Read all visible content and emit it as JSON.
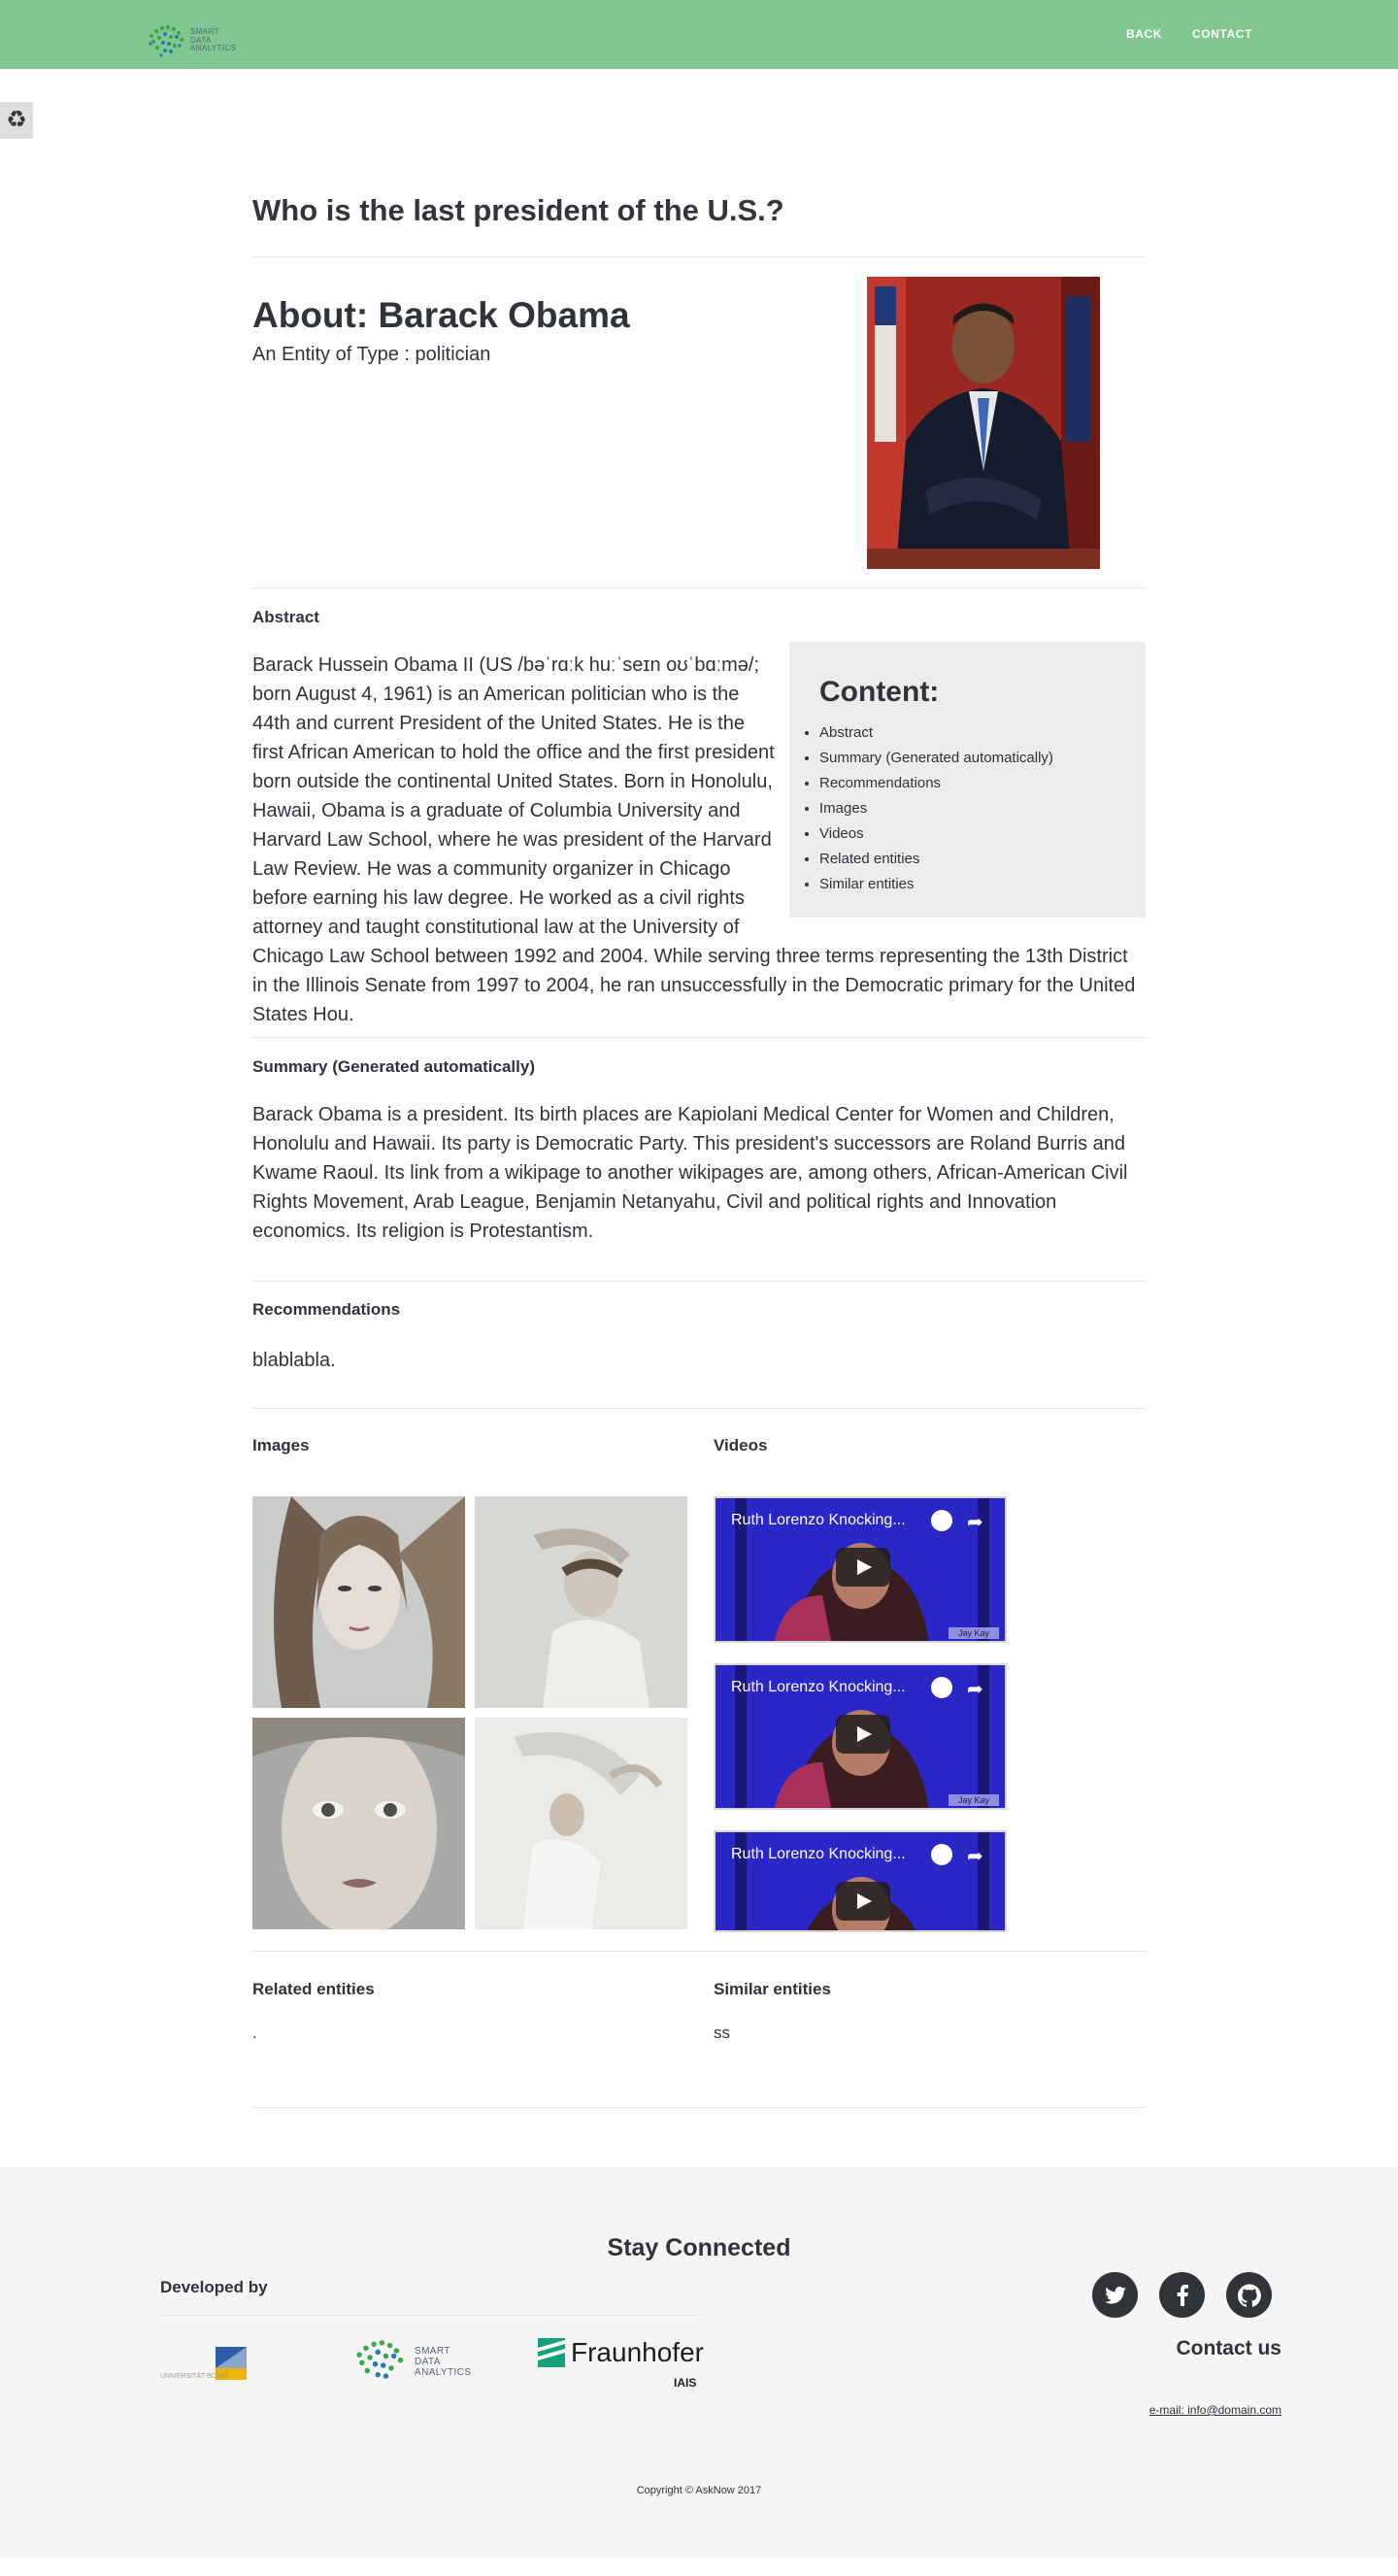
{
  "nav": {
    "brand": [
      "SMART",
      "DATA",
      "ANALYTICS"
    ],
    "links": [
      "BACK",
      "CONTACT"
    ]
  },
  "side_tab_icon": "recycle-icon",
  "question": "Who is the last president of the U.S.?",
  "about": {
    "title": "About: Barack Obama",
    "type_line": "An Entity of Type : politician"
  },
  "abstract": {
    "label": "Abstract",
    "text": "Barack Hussein Obama II (US /bəˈrɑːk huːˈseɪn oʊˈbɑːmə/; born August 4, 1961) is an American politician who is the 44th and current President of the United States. He is the first African American to hold the office and the first president born outside the continental United States. Born in Honolulu, Hawaii, Obama is a graduate of Columbia University and Harvard Law School, where he was president of the Harvard Law Review. He was a community organizer in Chicago before earning his law degree. He worked as a civil rights attorney and taught constitutional law at the University of Chicago Law School between 1992 and 2004. While serving three terms representing the 13th District in the Illinois Senate from 1997 to 2004, he ran unsuccessfully in the Democratic primary for the United States Hou."
  },
  "contents": {
    "title": "Content:",
    "items": [
      "Abstract",
      "Summary (Generated automatically)",
      "Recommendations",
      "Images",
      "Videos",
      "Related entities",
      "Similar entities"
    ]
  },
  "summary": {
    "label": "Summary (Generated automatically)",
    "text": "Barack Obama is a president. Its birth places are Kapiolani Medical Center for Women and Children, Honolulu and Hawaii. Its party is Democratic Party. This president's successors are Roland Burris and Kwame Raoul. Its link from a wikipage to another wikipages are, among others, African-American Civil Rights Movement, Arab League, Benjamin Netanyahu, Civil and political rights and Innovation economics. Its religion is Protestantism."
  },
  "recommendations": {
    "label": "Recommendations",
    "text": "blablabla."
  },
  "images": {
    "label": "Images"
  },
  "videos": {
    "label": "Videos",
    "items": [
      {
        "title": "Ruth Lorenzo Knocking...",
        "tag": "Jay Kay"
      },
      {
        "title": "Ruth Lorenzo Knocking...",
        "tag": "Jay Kay"
      },
      {
        "title": "Ruth Lorenzo Knocking...",
        "tag": ""
      }
    ]
  },
  "related": {
    "label": "Related entities",
    "text": "."
  },
  "similar": {
    "label": "Similar entities",
    "text": "ss"
  },
  "footer": {
    "stay": "Stay Connected",
    "developed_by": "Developed by",
    "uni_text": "UNIVERSITÄT BONN",
    "sda_text": [
      "SMART",
      "DATA",
      "ANALYTICS"
    ],
    "fraunhofer": "Fraunhofer",
    "iais": "IAIS",
    "social_icons": [
      "twitter-icon",
      "facebook-icon",
      "github-icon"
    ],
    "contact_us": "Contact us",
    "email": "e-mail: info@domain.com",
    "copyright": "Copyright © AskNow 2017"
  },
  "colors": {
    "nav": "#7fc78e",
    "text": "#2f3438",
    "footer_bg": "#f5f5f5",
    "content_box": "#ececec"
  }
}
